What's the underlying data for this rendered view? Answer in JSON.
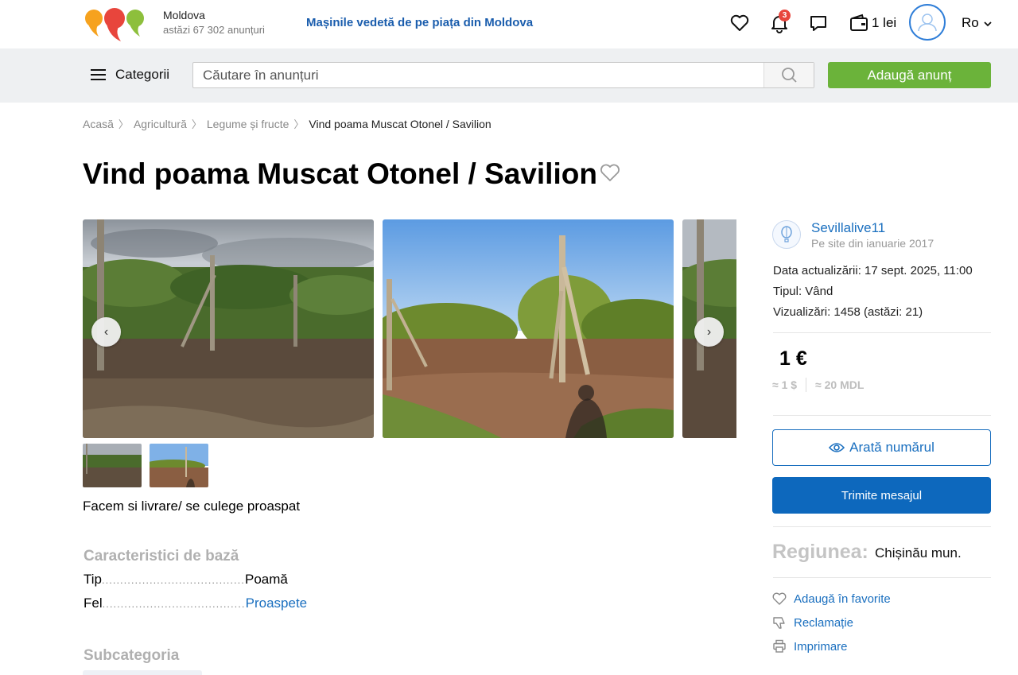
{
  "header": {
    "region_name": "Moldova",
    "region_count": "astăzi 67 302 anunțuri",
    "promo": "Mașinile vedetă de pe piața din Moldova",
    "notifications_count": "3",
    "wallet": "1 lei",
    "language": "Ro",
    "icons": [
      "logo",
      "heart-icon",
      "bell-icon",
      "chat-icon",
      "wallet-icon",
      "avatar-icon",
      "chevron-down-icon"
    ]
  },
  "searchbar": {
    "categories_label": "Categorii",
    "search_placeholder": "Căutare în anunțuri",
    "add_button": "Adaugă anunț"
  },
  "breadcrumb": [
    "Acasă",
    "Agricultură",
    "Legume și fructe",
    "Vind poama Muscat Otonel / Savilion"
  ],
  "listing": {
    "title": "Vind poama Muscat Otonel / Savilion",
    "description": "Facem si livrare/ se culege proaspat",
    "characteristics_title": "Caracteristici de bază",
    "characteristics": [
      {
        "key": "Tip",
        "value": "Poamă",
        "link": false
      },
      {
        "key": "Fel",
        "value": "Proaspete",
        "link": true
      }
    ],
    "subcategory_title": "Subcategoria",
    "photos": [
      "vineyard-cloudy-sky",
      "vineyard-blue-sky-shadow"
    ]
  },
  "seller": {
    "name": "Sevillalive11",
    "since": "Pe site din ianuarie 2017",
    "updated": "Data actualizării: 17 sept. 2025, 11:00",
    "type": "Tipul: Vând",
    "views": "Vizualizări: 1458 (astăzi: 21)"
  },
  "price": {
    "main": "1 €",
    "usd": "≈ 1 $",
    "mdl": "≈ 20 MDL"
  },
  "actions": {
    "show_number": "Arată numărul",
    "send_message": "Trimite mesajul",
    "region_label": "Regiunea:",
    "region_value": "Chișinău mun.",
    "favorite": "Adaugă în favorite",
    "complaint": "Reclamație",
    "print": "Imprimare"
  },
  "colors": {
    "brand_orange": "#f6a21e",
    "brand_red": "#e8453c",
    "brand_green": "#8dbf3c",
    "primary_blue": "#0d68bd",
    "add_green": "#6bb33a"
  }
}
